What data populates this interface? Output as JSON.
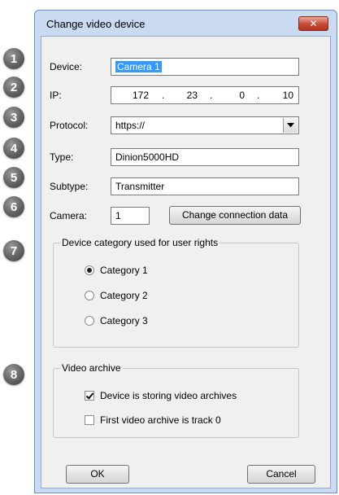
{
  "badges": [
    "1",
    "2",
    "3",
    "4",
    "5",
    "6",
    "7",
    "8"
  ],
  "window": {
    "title": "Change video device",
    "close_glyph": "✕"
  },
  "form": {
    "device_label": "Device:",
    "device_value": "Camera 1",
    "ip_label": "IP:",
    "ip_octets": [
      "172",
      "23",
      "0",
      "10"
    ],
    "ip_separator": ".",
    "protocol_label": "Protocol:",
    "protocol_value": "https://",
    "type_label": "Type:",
    "type_value": "Dinion5000HD",
    "subtype_label": "Subtype:",
    "subtype_value": "Transmitter",
    "camera_label": "Camera:",
    "camera_value": "1",
    "change_connection_label": "Change connection data"
  },
  "category_group": {
    "legend": "Device category used for user rights",
    "options": [
      "Category 1",
      "Category 2",
      "Category 3"
    ],
    "selected_index": 0
  },
  "archive_group": {
    "legend": "Video archive",
    "checks": [
      {
        "label": "Device is storing video archives",
        "checked": true
      },
      {
        "label": "First video archive is track 0",
        "checked": false
      }
    ]
  },
  "buttons": {
    "ok": "OK",
    "cancel": "Cancel"
  },
  "icons": {
    "close": "close-icon",
    "dropdown": "chevron-down-icon"
  },
  "colors": {
    "selection": "#3399ff",
    "close_button": "#c84a35",
    "badge": "#5a5a5a"
  }
}
